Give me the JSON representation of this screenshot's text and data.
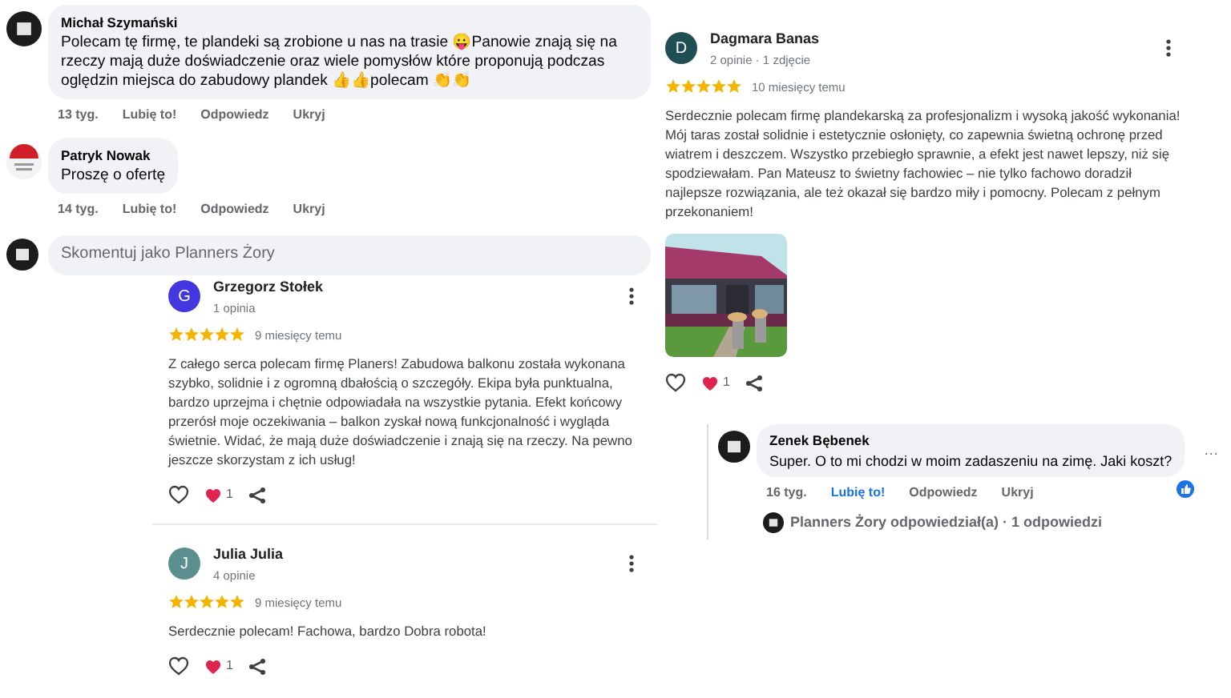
{
  "comments": [
    {
      "author": "Michał Szymański",
      "text": "Polecam tę firmę, te plandeki są zrobione u nas na trasie 😛Panowie znają się na rzeczy mają duże doświadczenie oraz wiele pomysłów które proponują podczas oględzin miejsca do zabudowy plandek 👍👍polecam 👏👏",
      "time": "13 tyg.",
      "liked": false,
      "actions": [
        "Lubię to!",
        "Odpowiedz",
        "Ukryj"
      ]
    },
    {
      "author": "Patryk Nowak",
      "text": "Proszę o ofertę",
      "time": "14 tyg.",
      "liked": false,
      "actions": [
        "Lubię to!",
        "Odpowiedz",
        "Ukryj"
      ]
    }
  ],
  "comment_field": {
    "placeholder": "Skomentuj jako Planners Żory"
  },
  "reviews": [
    {
      "author": "Dagmara Banas",
      "avatar_letter": "D",
      "color": "#1f4f52",
      "meta": "2 opinie · 1 zdjęcie",
      "stars": 5,
      "time": "10 miesięcy temu",
      "text": "Serdecznie polecam firmę plandekarską za profesjonalizm i wysoką jakość wykonania! Mój taras został solidnie i estetycznie osłonięty, co zapewnia świetną ochronę przed wiatrem i deszczem. Wszystko przebiegło sprawnie, a efekt jest nawet lepszy, niż się spodziewałam. Pan Mateusz to świetny fachowiec – nie tylko fachowo doradził najlepsze rozwiązania, ale też okazał się bardzo miły i pomocny. Polecam z pełnym przekonaniem!",
      "hearts": "1"
    },
    {
      "author": "Grzegorz Stołek",
      "avatar_letter": "G",
      "color": "#4338e0",
      "meta": "1 opinia",
      "stars": 5,
      "time": "9 miesięcy temu",
      "text": "Z całego serca polecam firmę Planers! Zabudowa balkonu została wykonana szybko, solidnie i z ogromną dbałością o szczegóły. Ekipa była punktualna, bardzo uprzejma i chętnie odpowiadała na wszystkie pytania. Efekt końcowy przerósł moje oczekiwania – balkon zyskał nową funkcjonalność i wygląda świetnie. Widać, że mają duże doświadczenie i znają się na rzeczy. Na pewno jeszcze skorzystam z ich usług!",
      "hearts": "1"
    },
    {
      "author": "Julia Julia",
      "avatar_letter": "J",
      "color": "#5b8f8f",
      "meta": "4 opinie",
      "stars": 5,
      "time": "9 miesięcy temu",
      "text": "Serdecznie polecam! Fachowa, bardzo Dobra robota!",
      "hearts": "1"
    }
  ],
  "reply_thread": {
    "author": "Zenek Bębenek",
    "text": "Super. O to mi chodzi w moim zadaszeniu na zimę. Jaki koszt?",
    "time": "16 tyg.",
    "liked": true,
    "actions": [
      "Lubię to!",
      "Odpowiedz",
      "Ukryj"
    ],
    "more": "···",
    "replies_summary": "Planners Żory odpowiedział(a) · 1 odpowiedzi"
  }
}
